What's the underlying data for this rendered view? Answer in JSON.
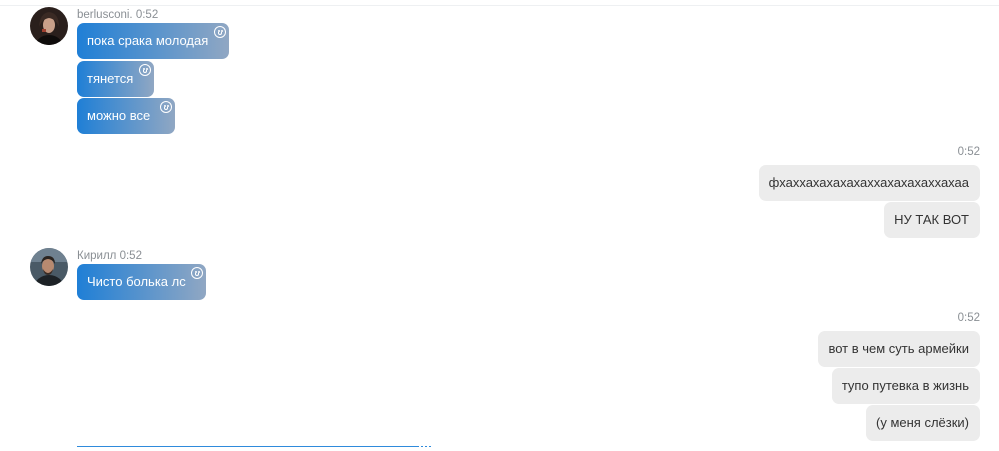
{
  "group1": {
    "sender": "berlusconi.",
    "time": "0:52",
    "messages": [
      "пока срака молодая",
      "тянется",
      "можно все"
    ]
  },
  "out1": {
    "time": "0:52",
    "messages": [
      "фхаххахахахахаххахахахаххахаа",
      "НУ ТАК ВОТ"
    ]
  },
  "group2": {
    "sender": "Кирилл",
    "time": "0:52",
    "messages": [
      "Чисто болька лс"
    ]
  },
  "out2": {
    "time": "0:52",
    "messages": [
      "вот в чем суть армейки",
      "тупо путевка в жизнь",
      "(у меня слёзки)"
    ]
  },
  "colors": {
    "incoming_gradient_start": "#1f7fd6",
    "incoming_gradient_end": "#90a7c3",
    "outgoing_bg": "#ececec"
  },
  "icons": {
    "reaction": "smiley-icon"
  }
}
